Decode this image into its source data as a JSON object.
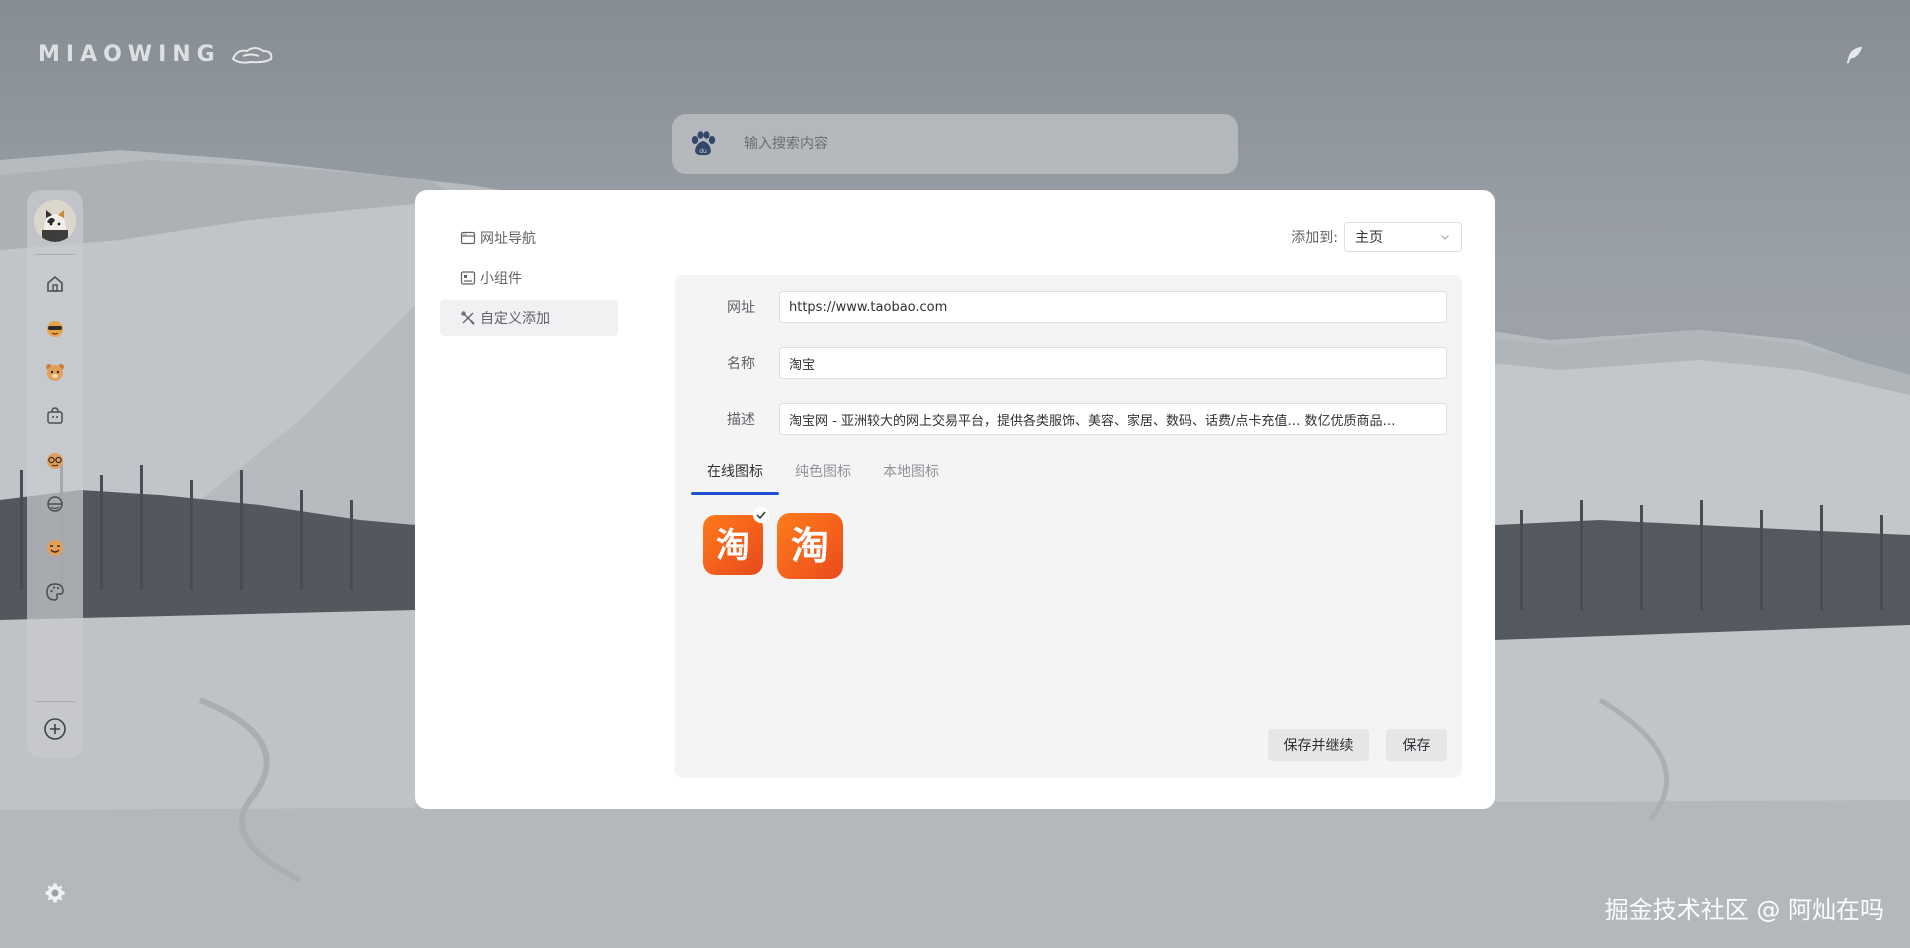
{
  "app": {
    "logo_text": "MIAOWING",
    "watermark": "掘金技术社区 @ 阿灿在吗"
  },
  "search": {
    "placeholder": "输入搜索内容",
    "engine_icon": "baidu-paw-icon"
  },
  "sidebar": {
    "items": [
      {
        "icon": "home-icon"
      },
      {
        "icon": "cool-cat-icon"
      },
      {
        "icon": "bear-icon"
      },
      {
        "icon": "bag-icon"
      },
      {
        "icon": "glasses-face-icon"
      },
      {
        "icon": "helmet-icon"
      },
      {
        "icon": "smile-face-icon"
      },
      {
        "icon": "palette-icon"
      }
    ],
    "add_icon": "plus-circle-icon",
    "settings_icon": "gear-icon"
  },
  "modal": {
    "menu": [
      {
        "label": "网址导航",
        "icon": "browser-icon",
        "active": false
      },
      {
        "label": "小组件",
        "icon": "widget-icon",
        "active": false
      },
      {
        "label": "自定义添加",
        "icon": "tools-icon",
        "active": true
      }
    ],
    "add_to_label": "添加到:",
    "add_to_value": "主页",
    "form": {
      "url_label": "网址",
      "url_value": "https://www.taobao.com",
      "name_label": "名称",
      "name_value": "淘宝",
      "desc_label": "描述",
      "desc_value": "淘宝网 - 亚洲较大的网上交易平台，提供各类服饰、美容、家居、数码、话费/点卡充值… 数亿优质商品…"
    },
    "tabs": [
      {
        "label": "在线图标",
        "active": true
      },
      {
        "label": "纯色图标",
        "active": false
      },
      {
        "label": "本地图标",
        "active": false
      }
    ],
    "icon_glyph": "淘",
    "brand_color": "#f25c13",
    "buttons": {
      "save_continue": "保存并继续",
      "save": "保存"
    }
  }
}
